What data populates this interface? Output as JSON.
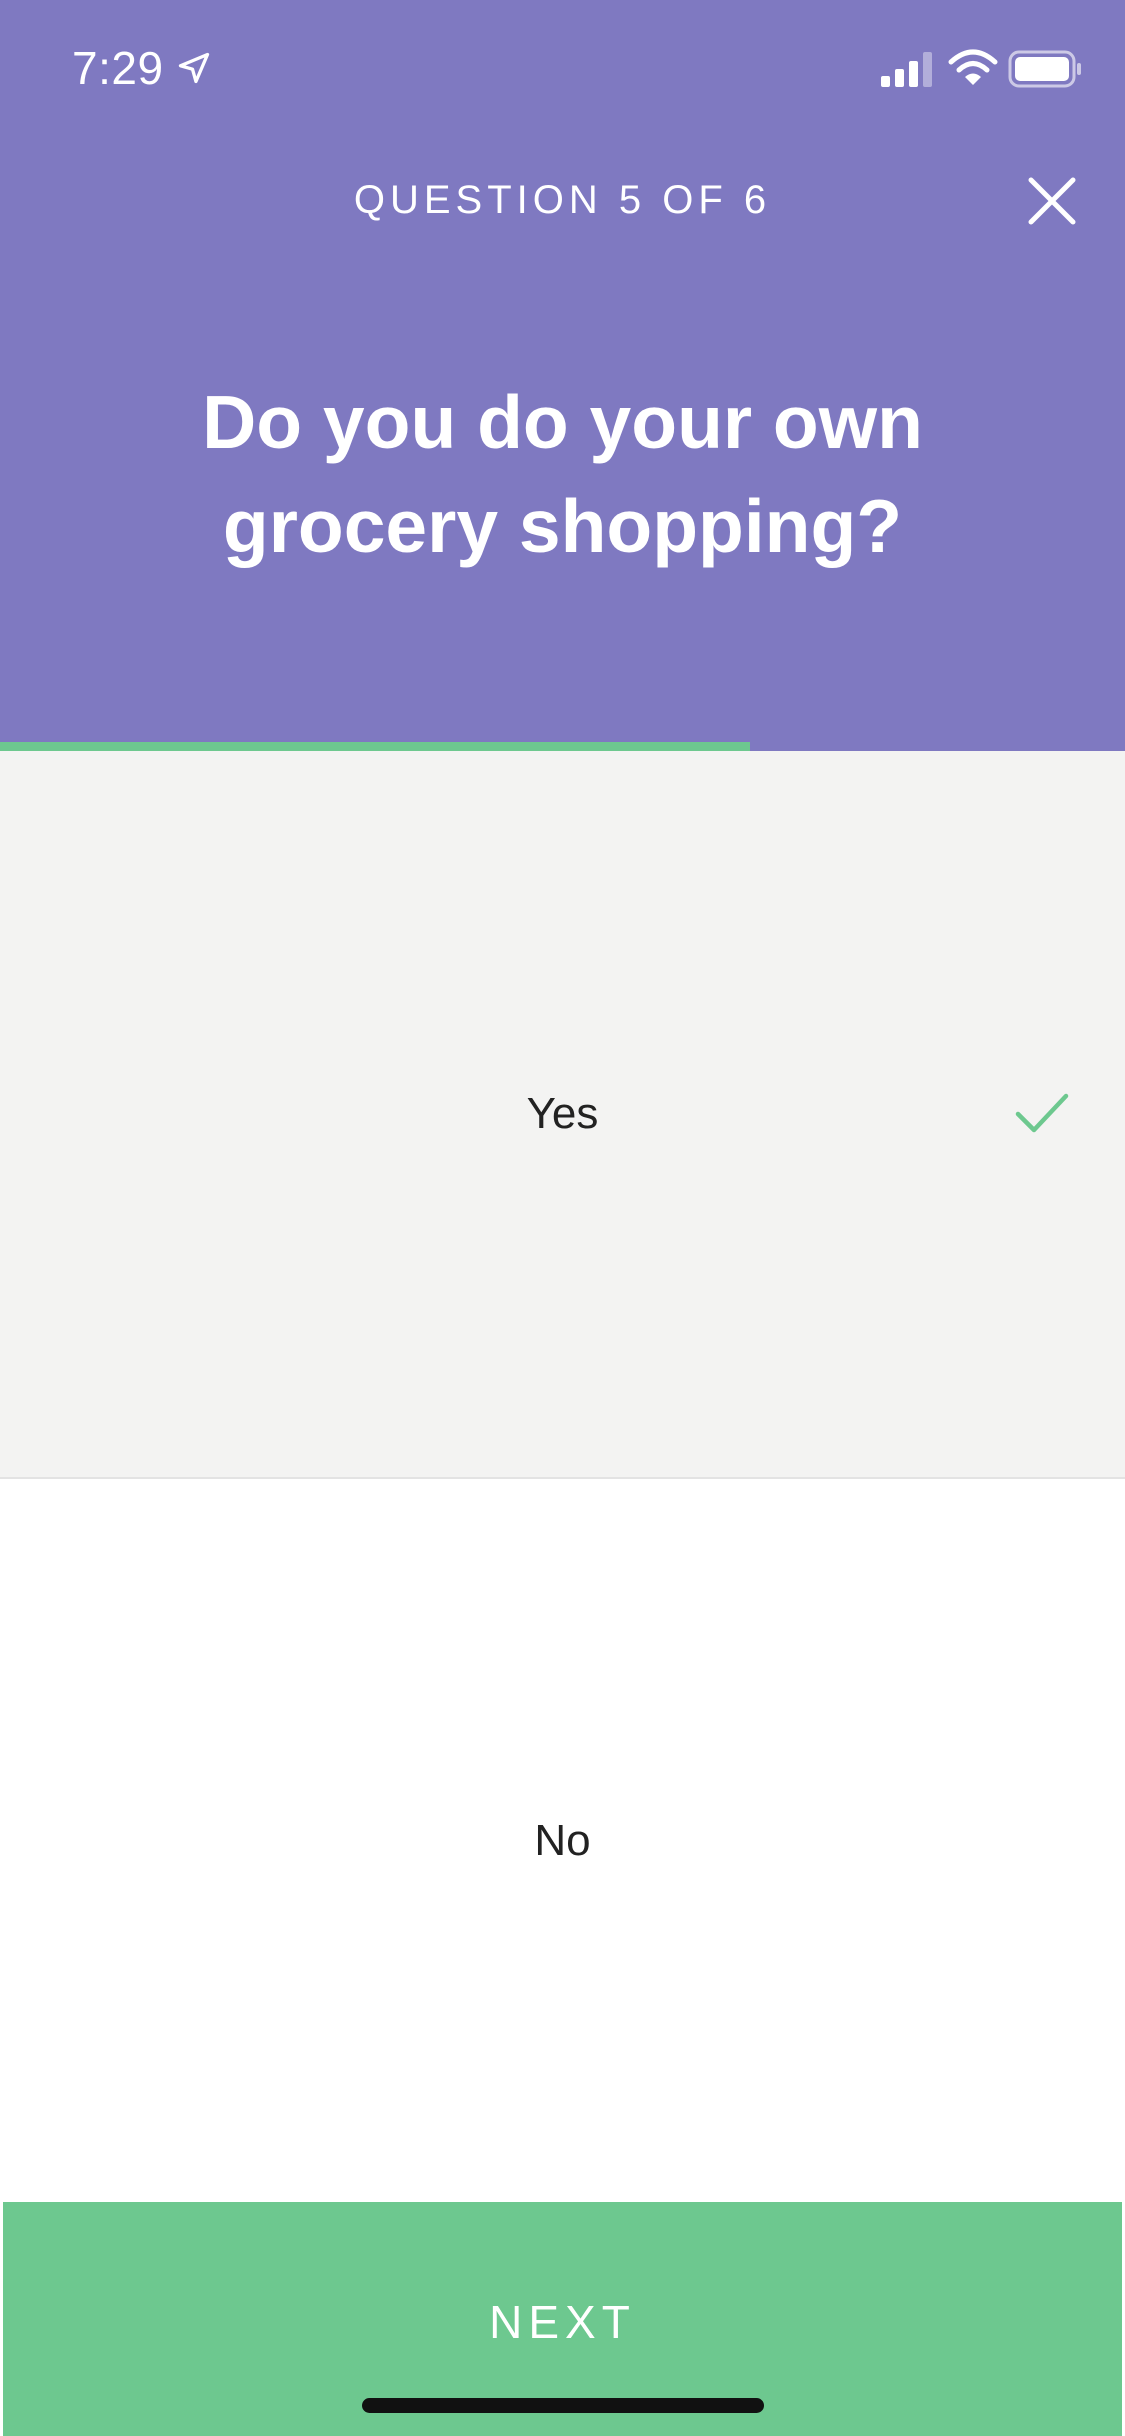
{
  "status_bar": {
    "time": "7:29",
    "icons": [
      "location-arrow-icon",
      "cellular-signal-icon",
      "wifi-icon",
      "battery-icon"
    ]
  },
  "header": {
    "question_counter": "QUESTION 5 OF 6",
    "question_title": "Do you do your own grocery shopping?",
    "close_icon": "close-icon"
  },
  "progress": {
    "fraction": 0.667
  },
  "options": [
    {
      "label": "Yes",
      "selected": true,
      "selected_icon": "checkmark-icon"
    },
    {
      "label": "No",
      "selected": false
    }
  ],
  "footer": {
    "next_label": "NEXT"
  },
  "colors": {
    "header_background": "#7f79c1",
    "accent_green": "#6dc88f",
    "selected_option_background": "#f3f3f2",
    "text_dark": "#222222",
    "text_light": "#ffffff"
  }
}
